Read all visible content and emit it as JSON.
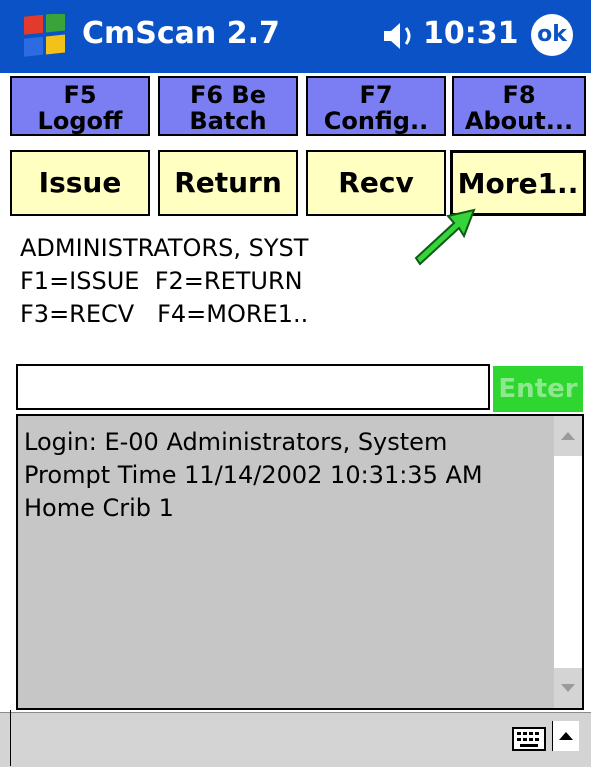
{
  "titlebar": {
    "app_title": "CmScan 2.7",
    "clock": "10:31",
    "ok_label": "ok"
  },
  "function_keys": [
    {
      "line1": "F5",
      "line2": "Logoff"
    },
    {
      "line1": "F6 Be",
      "line2": "Batch"
    },
    {
      "line1": "F7",
      "line2": "Config.."
    },
    {
      "line1": "F8",
      "line2": "About..."
    }
  ],
  "actions": [
    {
      "label": "Issue"
    },
    {
      "label": "Return"
    },
    {
      "label": "Recv"
    },
    {
      "label": "More1.."
    }
  ],
  "info_lines": [
    "ADMINISTRATORS, SYST",
    "F1=ISSUE  F2=RETURN",
    "F3=RECV   F4=MORE1.."
  ],
  "entry": {
    "value": "",
    "button_label": "Enter"
  },
  "log_lines": [
    "Login: E-00 Administrators, System",
    "Prompt Time 11/14/2002 10:31:35 AM",
    "Home Crib 1"
  ],
  "colors": {
    "titlebar": "#0a52c6",
    "function_key": "#7a7ef2",
    "action_button": "#ffffc2",
    "enter_button": "#2fd62f",
    "log_background": "#c6c6c6",
    "annotation_arrow": "#2ecc40"
  },
  "icons": {
    "start": "windows-flag-icon",
    "volume": "speaker-icon",
    "keyboard": "keyboard-icon",
    "sip_toggle": "up-arrow-icon",
    "annotation": "green-arrow-icon"
  }
}
